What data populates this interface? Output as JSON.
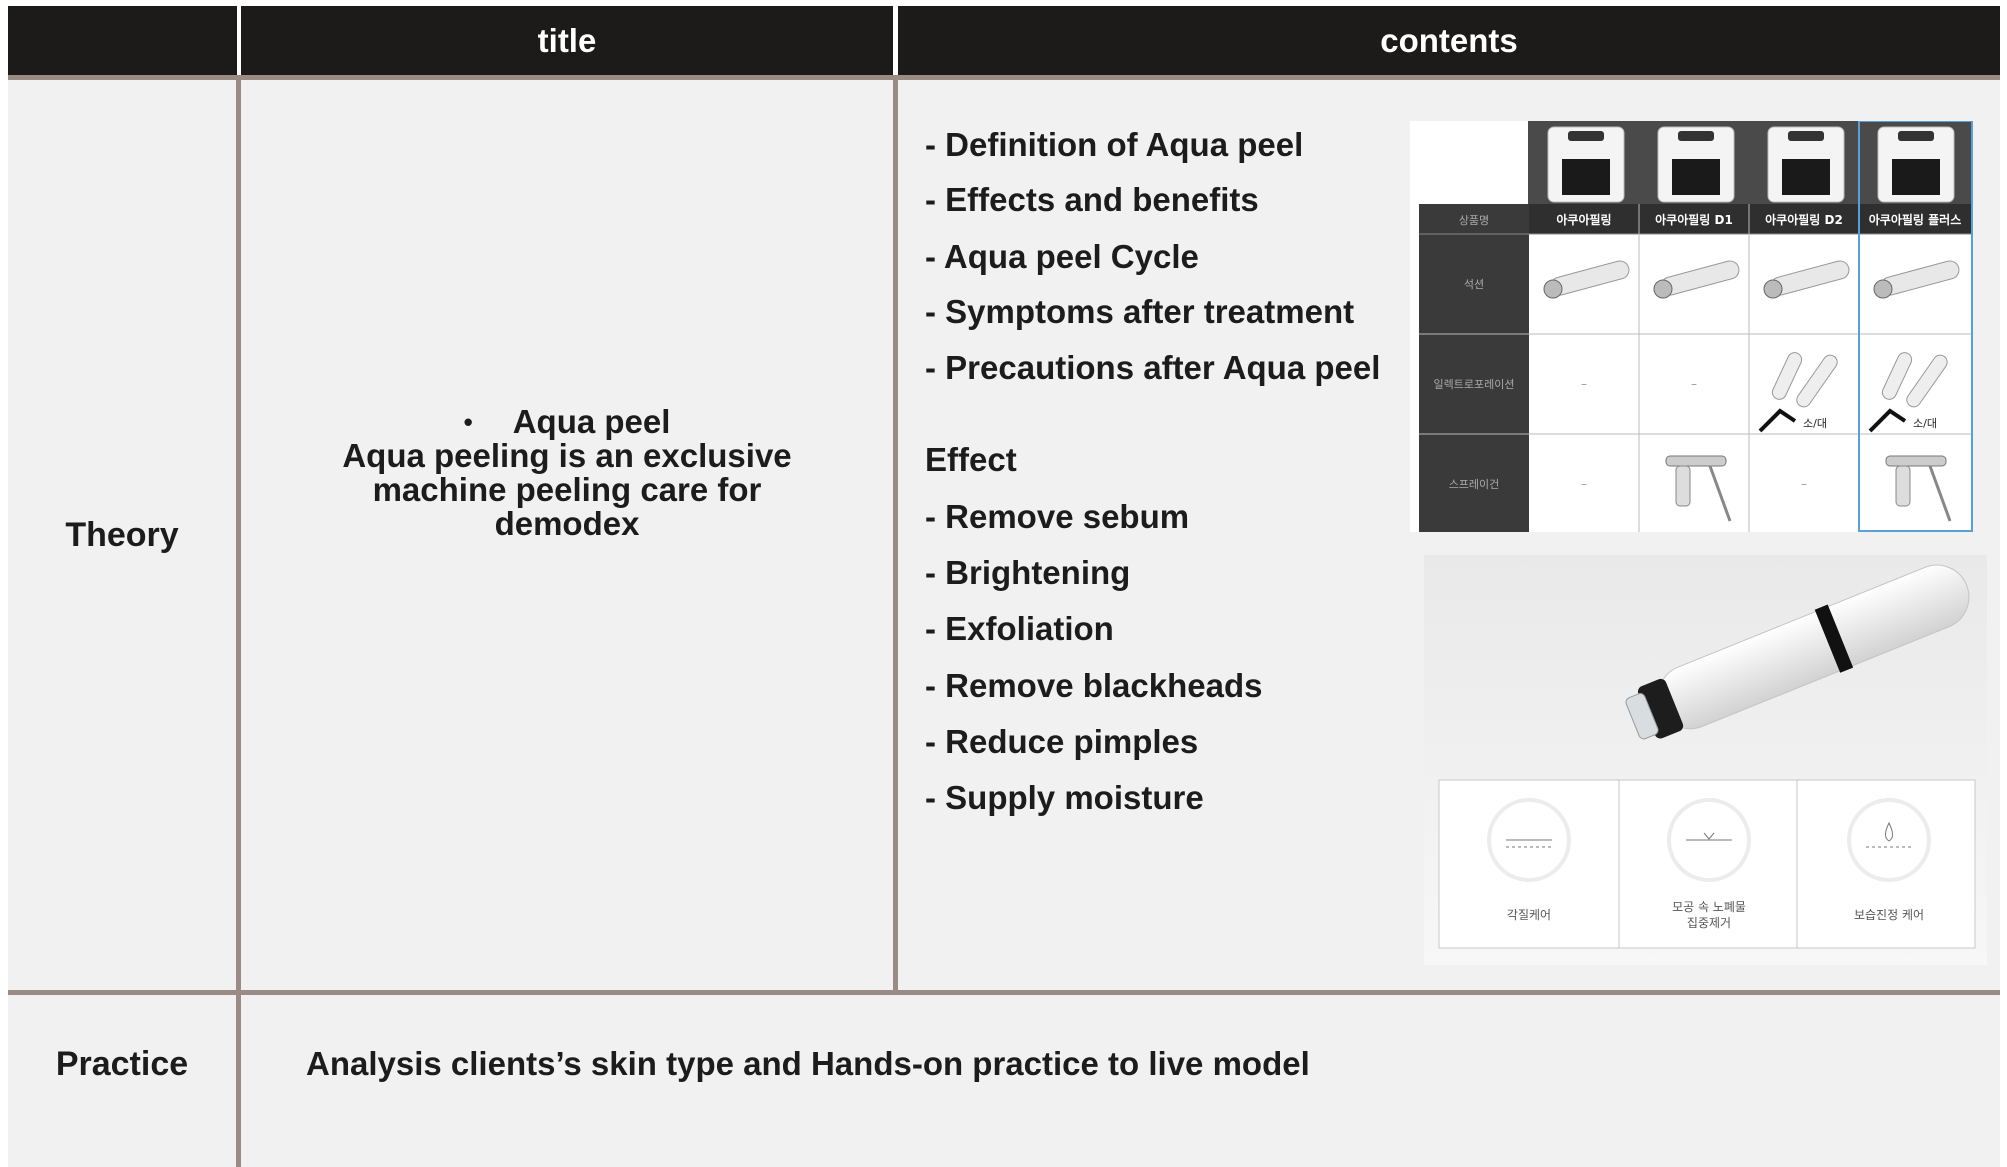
{
  "header": {
    "col0": "",
    "col1": "title",
    "col2": "contents"
  },
  "rows": {
    "theory": {
      "label": "Theory",
      "title_bullet": "•",
      "title_heading": "Aqua peel",
      "title_desc_1": "Aqua peeling is an exclusive",
      "title_desc_2": "machine peeling care for",
      "title_desc_3": "demodex",
      "contents_items": [
        "- Definition of Aqua peel",
        "- Effects and benefits",
        "- Aqua peel Cycle",
        "- Symptoms after treatment",
        "- Precautions after Aqua peel"
      ],
      "effect_heading": "Effect",
      "effect_items": [
        "- Remove sebum",
        "- Brightening",
        "- Exfoliation",
        "- Remove blackheads",
        "- Reduce pimples",
        "- Supply moisture"
      ]
    },
    "practice": {
      "label": "Practice",
      "text": "Analysis clients’s skin type and Hands-on practice to live model"
    }
  },
  "product_table": {
    "row_headers": [
      "상품명",
      "석션",
      "일렉트로포레이션",
      "스프레이건"
    ],
    "products": [
      "아쿠아필링",
      "아쿠아필링 D1",
      "아쿠아필링 D2",
      "아쿠아필링 플러스"
    ],
    "dash": "–",
    "size_label": "소/대"
  },
  "care_icons": {
    "labels": [
      "각질케어",
      "모공 속 노폐물",
      "집중제거",
      "보습진정 케어"
    ]
  },
  "colors": {
    "header_bg": "#1d1b1a",
    "rule": "#9b8b86",
    "cell_bg": "#f0f1f0"
  }
}
